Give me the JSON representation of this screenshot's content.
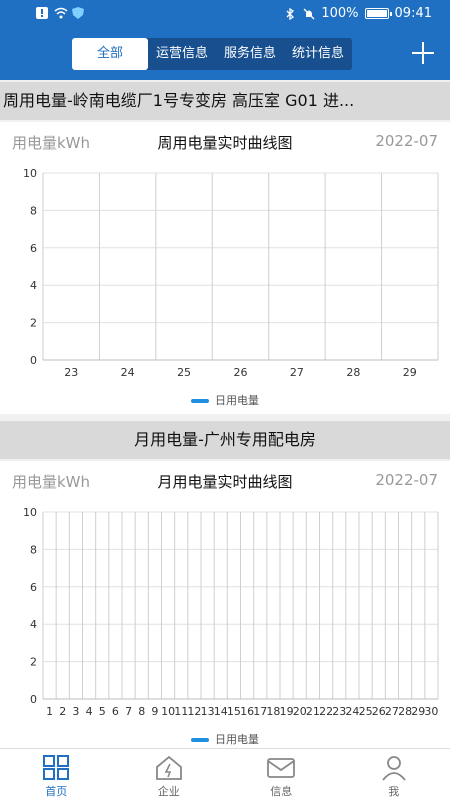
{
  "status_bar": {
    "battery": "100%",
    "time": "09:41"
  },
  "tabs": [
    {
      "label": "全部",
      "active": true
    },
    {
      "label": "运营信息",
      "active": false
    },
    {
      "label": "服务信息",
      "active": false
    },
    {
      "label": "统计信息",
      "active": false
    }
  ],
  "weekly": {
    "section_title": "周用电量-岭南电缆厂1号专变房 高压室 G01 进...",
    "unit": "用电量kWh",
    "title": "周用电量实时曲线图",
    "date": "2022-07",
    "legend": "日用电量",
    "chart_data": {
      "type": "line",
      "categories": [
        "23",
        "24",
        "25",
        "26",
        "27",
        "28",
        "29"
      ],
      "series": [
        {
          "name": "日用电量",
          "values": []
        }
      ],
      "ylim": [
        0,
        10
      ],
      "yticks": [
        "0",
        "2",
        "4",
        "6",
        "8",
        "10"
      ],
      "grid": true,
      "legend_position": "bottom-center",
      "color": "#1f8fe0"
    }
  },
  "monthly": {
    "section_title": "月用电量-广州专用配电房",
    "unit": "用电量kWh",
    "title": "月用电量实时曲线图",
    "date": "2022-07",
    "legend": "日用电量",
    "chart_data": {
      "type": "line",
      "categories": [
        "1",
        "2",
        "3",
        "4",
        "5",
        "6",
        "7",
        "8",
        "9",
        "10",
        "11",
        "12",
        "13",
        "14",
        "15",
        "16",
        "17",
        "18",
        "19",
        "20",
        "21",
        "22",
        "23",
        "24",
        "25",
        "26",
        "27",
        "28",
        "29",
        "30"
      ],
      "series": [
        {
          "name": "日用电量",
          "values": []
        }
      ],
      "ylim": [
        0,
        10
      ],
      "yticks": [
        "0",
        "2",
        "4",
        "6",
        "8",
        "10"
      ],
      "grid": true,
      "legend_position": "bottom-center",
      "color": "#1f8fe0"
    }
  },
  "bottom_nav": [
    {
      "label": "首页",
      "icon": "home-grid-icon",
      "active": true
    },
    {
      "label": "企业",
      "icon": "enterprise-icon",
      "active": false
    },
    {
      "label": "信息",
      "icon": "envelope-icon",
      "active": false
    },
    {
      "label": "我",
      "icon": "user-icon",
      "active": false
    }
  ],
  "colors": {
    "primary": "#1f6fc2",
    "tab_bg": "#174f8f",
    "series": "#1f8fe0"
  }
}
